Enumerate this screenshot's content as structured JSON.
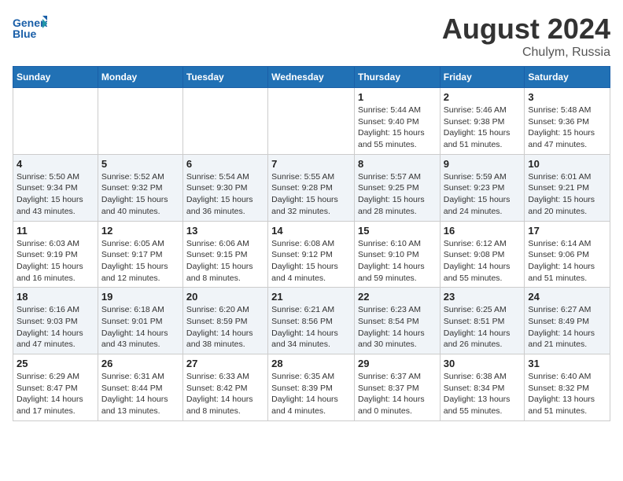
{
  "header": {
    "logo_line1": "General",
    "logo_line2": "Blue",
    "month_year": "August 2024",
    "location": "Chulym, Russia"
  },
  "weekdays": [
    "Sunday",
    "Monday",
    "Tuesday",
    "Wednesday",
    "Thursday",
    "Friday",
    "Saturday"
  ],
  "weeks": [
    [
      {
        "day": "",
        "info": ""
      },
      {
        "day": "",
        "info": ""
      },
      {
        "day": "",
        "info": ""
      },
      {
        "day": "",
        "info": ""
      },
      {
        "day": "1",
        "info": "Sunrise: 5:44 AM\nSunset: 9:40 PM\nDaylight: 15 hours\nand 55 minutes."
      },
      {
        "day": "2",
        "info": "Sunrise: 5:46 AM\nSunset: 9:38 PM\nDaylight: 15 hours\nand 51 minutes."
      },
      {
        "day": "3",
        "info": "Sunrise: 5:48 AM\nSunset: 9:36 PM\nDaylight: 15 hours\nand 47 minutes."
      }
    ],
    [
      {
        "day": "4",
        "info": "Sunrise: 5:50 AM\nSunset: 9:34 PM\nDaylight: 15 hours\nand 43 minutes."
      },
      {
        "day": "5",
        "info": "Sunrise: 5:52 AM\nSunset: 9:32 PM\nDaylight: 15 hours\nand 40 minutes."
      },
      {
        "day": "6",
        "info": "Sunrise: 5:54 AM\nSunset: 9:30 PM\nDaylight: 15 hours\nand 36 minutes."
      },
      {
        "day": "7",
        "info": "Sunrise: 5:55 AM\nSunset: 9:28 PM\nDaylight: 15 hours\nand 32 minutes."
      },
      {
        "day": "8",
        "info": "Sunrise: 5:57 AM\nSunset: 9:25 PM\nDaylight: 15 hours\nand 28 minutes."
      },
      {
        "day": "9",
        "info": "Sunrise: 5:59 AM\nSunset: 9:23 PM\nDaylight: 15 hours\nand 24 minutes."
      },
      {
        "day": "10",
        "info": "Sunrise: 6:01 AM\nSunset: 9:21 PM\nDaylight: 15 hours\nand 20 minutes."
      }
    ],
    [
      {
        "day": "11",
        "info": "Sunrise: 6:03 AM\nSunset: 9:19 PM\nDaylight: 15 hours\nand 16 minutes."
      },
      {
        "day": "12",
        "info": "Sunrise: 6:05 AM\nSunset: 9:17 PM\nDaylight: 15 hours\nand 12 minutes."
      },
      {
        "day": "13",
        "info": "Sunrise: 6:06 AM\nSunset: 9:15 PM\nDaylight: 15 hours\nand 8 minutes."
      },
      {
        "day": "14",
        "info": "Sunrise: 6:08 AM\nSunset: 9:12 PM\nDaylight: 15 hours\nand 4 minutes."
      },
      {
        "day": "15",
        "info": "Sunrise: 6:10 AM\nSunset: 9:10 PM\nDaylight: 14 hours\nand 59 minutes."
      },
      {
        "day": "16",
        "info": "Sunrise: 6:12 AM\nSunset: 9:08 PM\nDaylight: 14 hours\nand 55 minutes."
      },
      {
        "day": "17",
        "info": "Sunrise: 6:14 AM\nSunset: 9:06 PM\nDaylight: 14 hours\nand 51 minutes."
      }
    ],
    [
      {
        "day": "18",
        "info": "Sunrise: 6:16 AM\nSunset: 9:03 PM\nDaylight: 14 hours\nand 47 minutes."
      },
      {
        "day": "19",
        "info": "Sunrise: 6:18 AM\nSunset: 9:01 PM\nDaylight: 14 hours\nand 43 minutes."
      },
      {
        "day": "20",
        "info": "Sunrise: 6:20 AM\nSunset: 8:59 PM\nDaylight: 14 hours\nand 38 minutes."
      },
      {
        "day": "21",
        "info": "Sunrise: 6:21 AM\nSunset: 8:56 PM\nDaylight: 14 hours\nand 34 minutes."
      },
      {
        "day": "22",
        "info": "Sunrise: 6:23 AM\nSunset: 8:54 PM\nDaylight: 14 hours\nand 30 minutes."
      },
      {
        "day": "23",
        "info": "Sunrise: 6:25 AM\nSunset: 8:51 PM\nDaylight: 14 hours\nand 26 minutes."
      },
      {
        "day": "24",
        "info": "Sunrise: 6:27 AM\nSunset: 8:49 PM\nDaylight: 14 hours\nand 21 minutes."
      }
    ],
    [
      {
        "day": "25",
        "info": "Sunrise: 6:29 AM\nSunset: 8:47 PM\nDaylight: 14 hours\nand 17 minutes."
      },
      {
        "day": "26",
        "info": "Sunrise: 6:31 AM\nSunset: 8:44 PM\nDaylight: 14 hours\nand 13 minutes."
      },
      {
        "day": "27",
        "info": "Sunrise: 6:33 AM\nSunset: 8:42 PM\nDaylight: 14 hours\nand 8 minutes."
      },
      {
        "day": "28",
        "info": "Sunrise: 6:35 AM\nSunset: 8:39 PM\nDaylight: 14 hours\nand 4 minutes."
      },
      {
        "day": "29",
        "info": "Sunrise: 6:37 AM\nSunset: 8:37 PM\nDaylight: 14 hours\nand 0 minutes."
      },
      {
        "day": "30",
        "info": "Sunrise: 6:38 AM\nSunset: 8:34 PM\nDaylight: 13 hours\nand 55 minutes."
      },
      {
        "day": "31",
        "info": "Sunrise: 6:40 AM\nSunset: 8:32 PM\nDaylight: 13 hours\nand 51 minutes."
      }
    ]
  ]
}
